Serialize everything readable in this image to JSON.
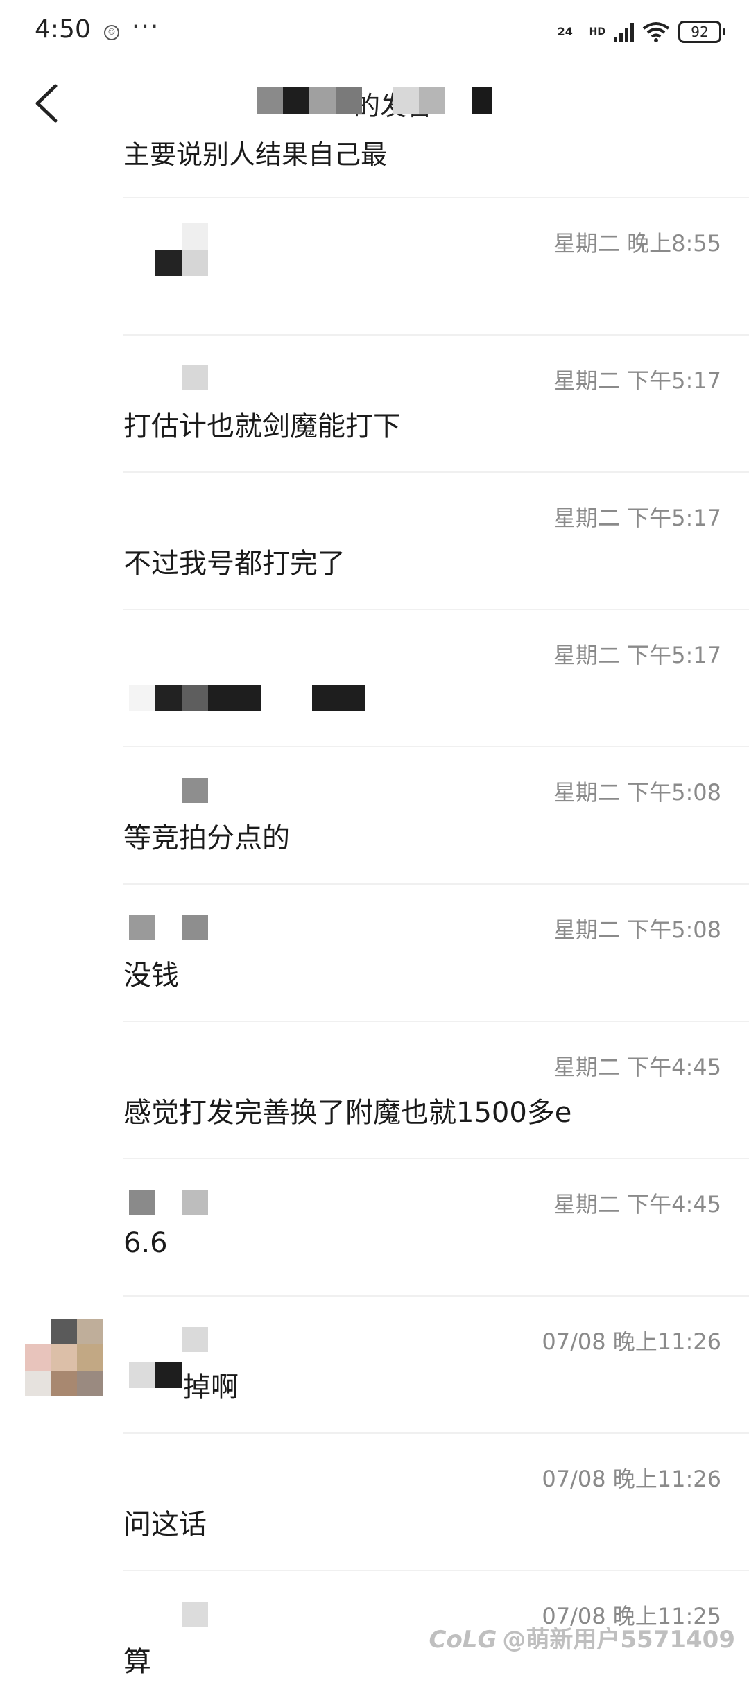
{
  "status_bar": {
    "time": "4:50",
    "network": "24",
    "hd": "HD",
    "battery": "92"
  },
  "header": {
    "title_visible": "的发言"
  },
  "partial_top_message": "主要说别人结果自己最",
  "items": [
    {
      "time": "星期二 晚上8:55",
      "message": ""
    },
    {
      "time": "星期二 下午5:17",
      "message": "打估计也就剑魔能打下"
    },
    {
      "time": "星期二 下午5:17",
      "message": "不过我号都打完了"
    },
    {
      "time": "星期二 下午5:17",
      "message": ""
    },
    {
      "time": "星期二 下午5:08",
      "message": "等竞拍分点的"
    },
    {
      "time": "星期二 下午5:08",
      "message": "没钱"
    },
    {
      "time": "星期二 下午4:45",
      "message": "感觉打发完善换了附魔也就1500多e"
    },
    {
      "time": "星期二 下午4:45",
      "message": "6.6"
    },
    {
      "time": "07/08 晚上11:26",
      "message": "掉啊"
    },
    {
      "time": "07/08 晚上11:26",
      "message": "问这话"
    },
    {
      "time": "07/08 晚上11:25",
      "message": "算"
    }
  ],
  "watermark": {
    "logo": "CoLG",
    "text": "@萌新用户5571409"
  }
}
